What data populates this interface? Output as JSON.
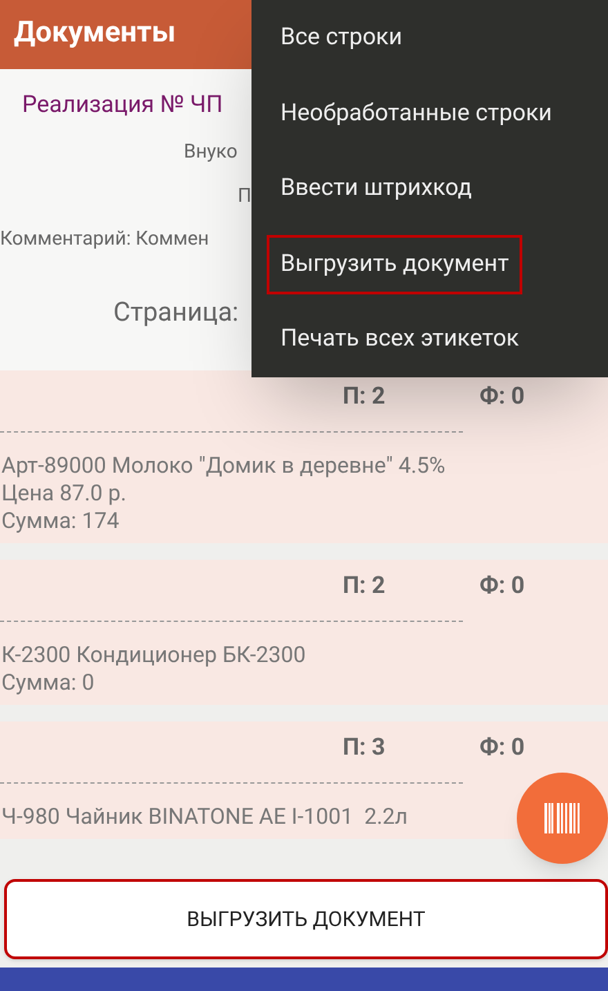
{
  "app_bar": {
    "title": "Документы"
  },
  "document": {
    "title": "Реализация № ЧП",
    "line_1": "Внуко",
    "line_2": "П",
    "comment": "Комментарий: Коммен",
    "page": "Страница:"
  },
  "items": [
    {
      "planned": "П: 2",
      "actual": "Ф: 0",
      "lines": [
        "Арт-89000 Молоко \"Домик в деревне\" 4.5%",
        "Цена 87.0 р.",
        "Сумма: 174"
      ]
    },
    {
      "planned": "П: 2",
      "actual": "Ф: 0",
      "lines": [
        "К-2300 Кондиционер БК-2300",
        "Сумма: 0"
      ]
    },
    {
      "planned": "П: 3",
      "actual": "Ф: 0",
      "lines": [
        "Ч-980 Чайник BINATONE AE I-1001  2.2л"
      ]
    }
  ],
  "menu": {
    "items": [
      {
        "label": "Все строки",
        "outlined": false
      },
      {
        "label": "Необработанные строки",
        "outlined": false
      },
      {
        "label": "Ввести штрихкод",
        "outlined": false
      },
      {
        "label": "Выгрузить документ",
        "outlined": true
      },
      {
        "label": "Печать всех этикеток",
        "outlined": false
      }
    ]
  },
  "bottom_button": {
    "label": "ВЫГРУЗИТЬ ДОКУМЕНТ",
    "outlined": true
  }
}
